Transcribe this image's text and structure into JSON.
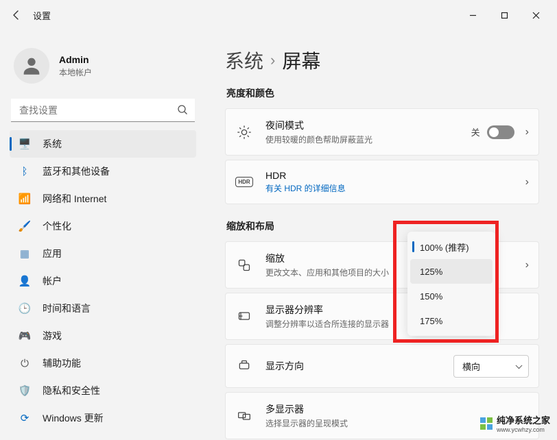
{
  "window": {
    "title": "设置"
  },
  "profile": {
    "name": "Admin",
    "subtitle": "本地帐户"
  },
  "search": {
    "placeholder": "查找设置"
  },
  "nav": [
    {
      "icon": "🖥️",
      "label": "系统",
      "color": "#0067c0",
      "selected": true
    },
    {
      "icon": "ᛒ",
      "label": "蓝牙和其他设备",
      "color": "#0067c0"
    },
    {
      "icon": "📶",
      "label": "网络和 Internet",
      "color": "#0aa3d8"
    },
    {
      "icon": "🖌️",
      "label": "个性化",
      "color": "#c96b2e"
    },
    {
      "icon": "▦",
      "label": "应用",
      "color": "#5a8fbf"
    },
    {
      "icon": "👤",
      "label": "帐户",
      "color": "#7a7a7a"
    },
    {
      "icon": "🕒",
      "label": "时间和语言",
      "color": "#555"
    },
    {
      "icon": "🎮",
      "label": "游戏",
      "color": "#6aa05a"
    },
    {
      "icon": "⏻",
      "label": "辅助功能",
      "color": "#555"
    },
    {
      "icon": "🛡️",
      "label": "隐私和安全性",
      "color": "#6a6a6a"
    },
    {
      "icon": "⟳",
      "label": "Windows 更新",
      "color": "#0067c0"
    }
  ],
  "breadcrumb": {
    "root": "系统",
    "leaf": "屏幕"
  },
  "sections": {
    "brightness": "亮度和颜色",
    "scale": "缩放和布局"
  },
  "cards": {
    "night": {
      "title": "夜间模式",
      "subtitle": "使用较暖的颜色帮助屏蔽蓝光",
      "toggle_label": "关"
    },
    "hdr": {
      "title": "HDR",
      "link": "有关 HDR 的详细信息"
    },
    "zoom": {
      "title": "缩放",
      "subtitle": "更改文本、应用和其他项目的大小"
    },
    "resolution": {
      "title": "显示器分辨率",
      "subtitle": "调整分辨率以适合所连接的显示器"
    },
    "orientation": {
      "title": "显示方向",
      "dropdown_partial": "横向"
    },
    "multi": {
      "title": "多显示器",
      "subtitle": "选择显示器的呈现模式"
    }
  },
  "scale_menu": {
    "items": [
      {
        "label": "100% (推荐)",
        "selected": true
      },
      {
        "label": "125%",
        "hover": true
      },
      {
        "label": "150%"
      },
      {
        "label": "175%"
      }
    ]
  },
  "watermark": {
    "name": "纯净系统之家",
    "url": "www.ycwhzy.com"
  },
  "icons": {
    "hdr_badge": "HDR"
  }
}
